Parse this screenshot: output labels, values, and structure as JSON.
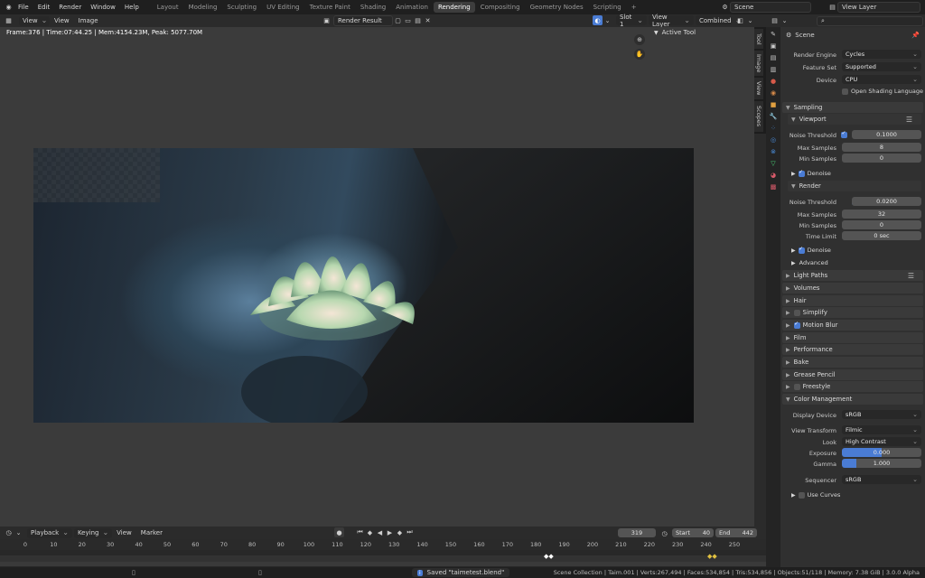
{
  "topbar": {
    "menus": [
      "File",
      "Edit",
      "Render",
      "Window",
      "Help"
    ],
    "workspaces": [
      "Layout",
      "Modeling",
      "Sculpting",
      "UV Editing",
      "Texture Paint",
      "Shading",
      "Animation",
      "Rendering",
      "Compositing",
      "Geometry Nodes",
      "Scripting"
    ],
    "active_workspace": "Rendering",
    "add_tab": "+",
    "scene": "Scene",
    "view_layer": "View Layer"
  },
  "image_editor": {
    "view_mode": "View",
    "menus": [
      "View",
      "Image"
    ],
    "image_name": "Render Result",
    "slot": "Slot 1",
    "layer": "View Layer",
    "pass": "Combined",
    "stats": "Frame:376 | Time:07:44.25 | Mem:4154.23M, Peak: 5077.70M",
    "active_tool_label": "Active Tool",
    "side_tabs": [
      "Tool",
      "Image",
      "View",
      "Scopes"
    ]
  },
  "properties": {
    "scene_label": "Scene",
    "render_engine_label": "Render Engine",
    "render_engine": "Cycles",
    "feature_set_label": "Feature Set",
    "feature_set": "Supported",
    "device_label": "Device",
    "device": "CPU",
    "osl_label": "Open Shading Language",
    "sampling": "Sampling",
    "viewport": "Viewport",
    "noise_threshold_label": "Noise Threshold",
    "viewport_noise_threshold": "0.1000",
    "max_samples_label": "Max Samples",
    "viewport_max_samples": "8",
    "min_samples_label": "Min Samples",
    "viewport_min_samples": "0",
    "denoise_label": "Denoise",
    "render": "Render",
    "render_noise_threshold": "0.0200",
    "render_max_samples": "32",
    "render_min_samples": "0",
    "time_limit_label": "Time Limit",
    "time_limit": "0 sec",
    "advanced": "Advanced",
    "panels": [
      "Light Paths",
      "Volumes",
      "Hair",
      "Simplify",
      "Motion Blur",
      "Film",
      "Performance",
      "Bake",
      "Grease Pencil",
      "Freestyle"
    ],
    "color_management": "Color Management",
    "display_device_label": "Display Device",
    "display_device": "sRGB",
    "view_transform_label": "View Transform",
    "view_transform": "Filmic",
    "look_label": "Look",
    "look": "High Contrast",
    "exposure_label": "Exposure",
    "exposure": "0.000",
    "gamma_label": "Gamma",
    "gamma": "1.000",
    "sequencer_label": "Sequencer",
    "sequencer": "sRGB",
    "use_curves_label": "Use Curves"
  },
  "timeline": {
    "menus": [
      "Playback",
      "Keying",
      "View",
      "Marker"
    ],
    "current_frame": "319",
    "start_label": "Start",
    "start": "40",
    "end_label": "End",
    "end": "442",
    "ticks": [
      "0",
      "10",
      "20",
      "30",
      "40",
      "50",
      "60",
      "70",
      "80",
      "90",
      "100",
      "110",
      "120",
      "130",
      "140",
      "150",
      "160",
      "170",
      "180",
      "190",
      "200",
      "210",
      "220",
      "230",
      "240",
      "250"
    ]
  },
  "status": {
    "message": "Saved \"taimetest.blend\"",
    "stats": "Scene Collection | Taim.001 | Verts:267,494 | Faces:534,854 | Tris:534,856 | Objects:51/118 | Memory: 7.38 GiB | 3.0.0 Alpha"
  }
}
